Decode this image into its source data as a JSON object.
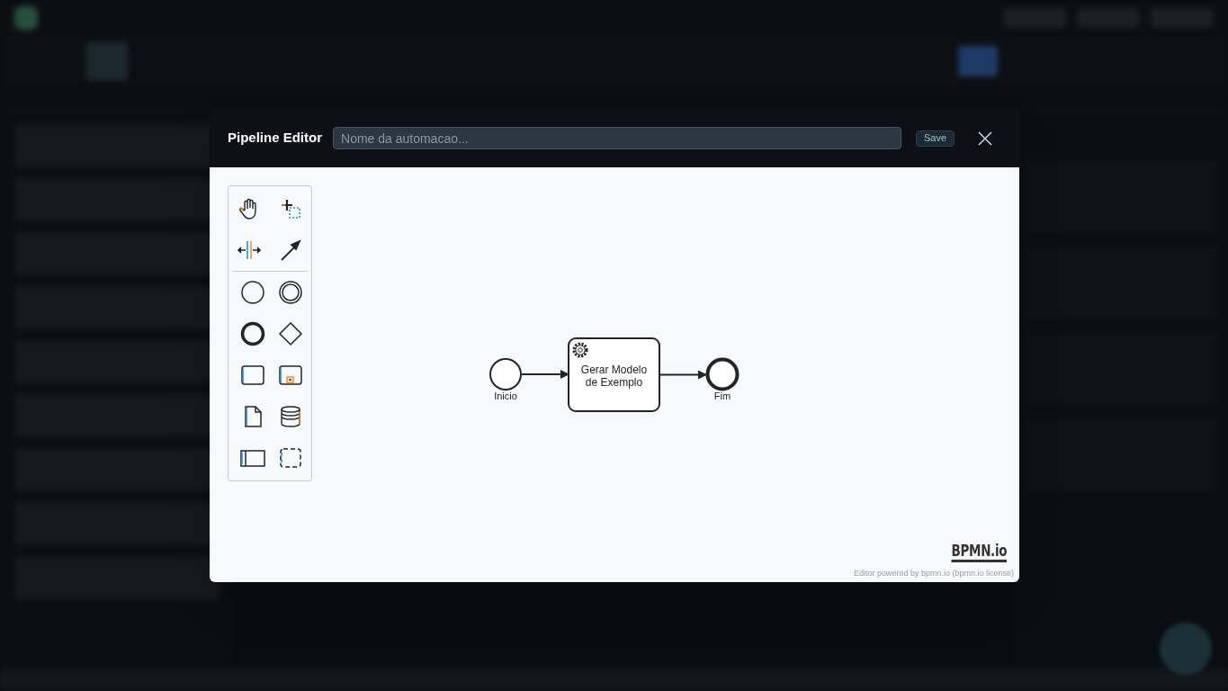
{
  "modal": {
    "title": "Pipeline Editor",
    "name_field": {
      "placeholder": "Nome da automacao..."
    },
    "save_button": "Save"
  },
  "palette": {
    "groups": [
      [
        {
          "kind": "hand"
        },
        {
          "kind": "lasso"
        },
        {
          "kind": "space"
        },
        {
          "kind": "connect"
        }
      ],
      [
        {
          "kind": "start-event"
        },
        {
          "kind": "intermediate-event"
        },
        {
          "kind": "end-event"
        },
        {
          "kind": "gateway"
        },
        {
          "kind": "task"
        },
        {
          "kind": "subprocess"
        },
        {
          "kind": "data-object"
        },
        {
          "kind": "data-store"
        },
        {
          "kind": "pool"
        },
        {
          "kind": "group"
        }
      ]
    ]
  },
  "diagram": {
    "nodes": [
      {
        "kind": "start",
        "label": [
          "Inicio"
        ]
      },
      {
        "kind": "service-task",
        "label": [
          "Gerar Modelo",
          "de Exemplo"
        ]
      },
      {
        "kind": "end",
        "label": [
          "Fim"
        ]
      }
    ]
  },
  "credits": {
    "logo": "BPMN.io",
    "text": "Editor powered by bpmn.io (bpmn.io license)"
  }
}
